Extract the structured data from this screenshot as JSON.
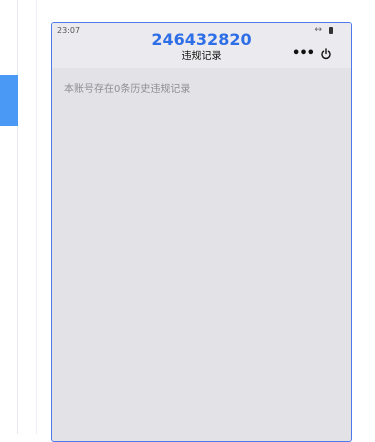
{
  "status_bar": {
    "time": "23:07"
  },
  "header": {
    "account_number": "246432820",
    "title": "违规记录"
  },
  "content": {
    "empty_message": "本账号存在0条历史违规记录"
  },
  "colors": {
    "accent": "#2e6ee6",
    "sidebar_accent": "#4a9af5",
    "page_bg": "#e3e2e7"
  }
}
